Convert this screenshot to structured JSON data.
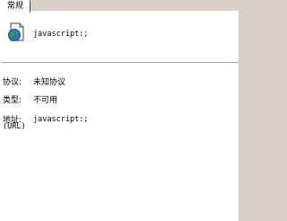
{
  "tab": {
    "label": "常规"
  },
  "header": {
    "address": "javascript:;"
  },
  "fields": {
    "protocol": {
      "label": "协议:",
      "value": "未知协议"
    },
    "type": {
      "label": "类型:",
      "value": "不可用"
    },
    "address": {
      "label": "地址:",
      "label_sub": "(URL)",
      "value": "javascript:;"
    }
  },
  "icons": {
    "page": "web-page-globe-icon"
  }
}
